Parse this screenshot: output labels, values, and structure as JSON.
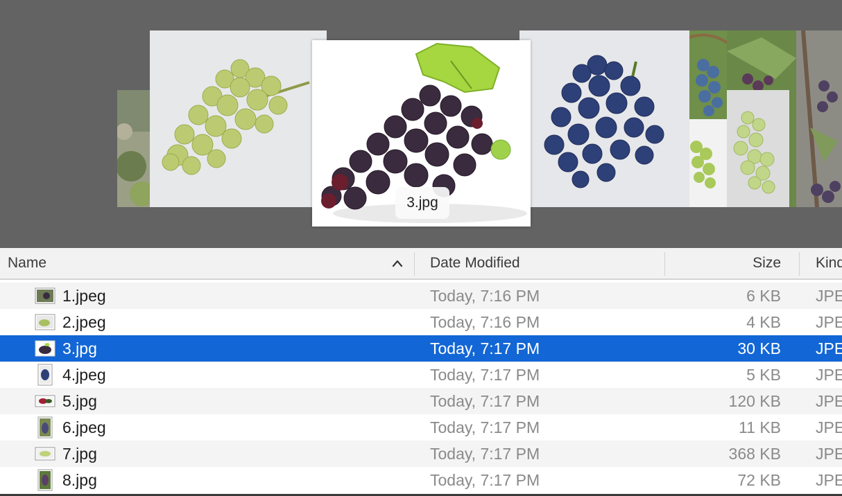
{
  "coverflow": {
    "caption": "3.jpg",
    "colors": {
      "background": "#636363",
      "green_grape": "#b6cc6e",
      "dark_grape": "#3a2a3c",
      "blue_grape": "#2d3f78",
      "leaf": "#a6d640"
    }
  },
  "columns": {
    "name": "Name",
    "date": "Date Modified",
    "size": "Size",
    "kind": "Kind",
    "sort_icon": "chevron-up-icon"
  },
  "files": [
    {
      "name": "1.jpeg",
      "date": "Today, 7:16 PM",
      "size": "6 KB",
      "kind": "JPEG"
    },
    {
      "name": "2.jpeg",
      "date": "Today, 7:16 PM",
      "size": "4 KB",
      "kind": "JPEG"
    },
    {
      "name": "3.jpg",
      "date": "Today, 7:17 PM",
      "size": "30 KB",
      "kind": "JPEG",
      "selected": true
    },
    {
      "name": "4.jpeg",
      "date": "Today, 7:17 PM",
      "size": "5 KB",
      "kind": "JPEG"
    },
    {
      "name": "5.jpg",
      "date": "Today, 7:17 PM",
      "size": "120 KB",
      "kind": "JPEG"
    },
    {
      "name": "6.jpeg",
      "date": "Today, 7:17 PM",
      "size": "11 KB",
      "kind": "JPEG"
    },
    {
      "name": "7.jpg",
      "date": "Today, 7:17 PM",
      "size": "368 KB",
      "kind": "JPEG"
    },
    {
      "name": "8.jpg",
      "date": "Today, 7:17 PM",
      "size": "72 KB",
      "kind": "JPEG"
    }
  ],
  "selection_color": "#1266d5"
}
